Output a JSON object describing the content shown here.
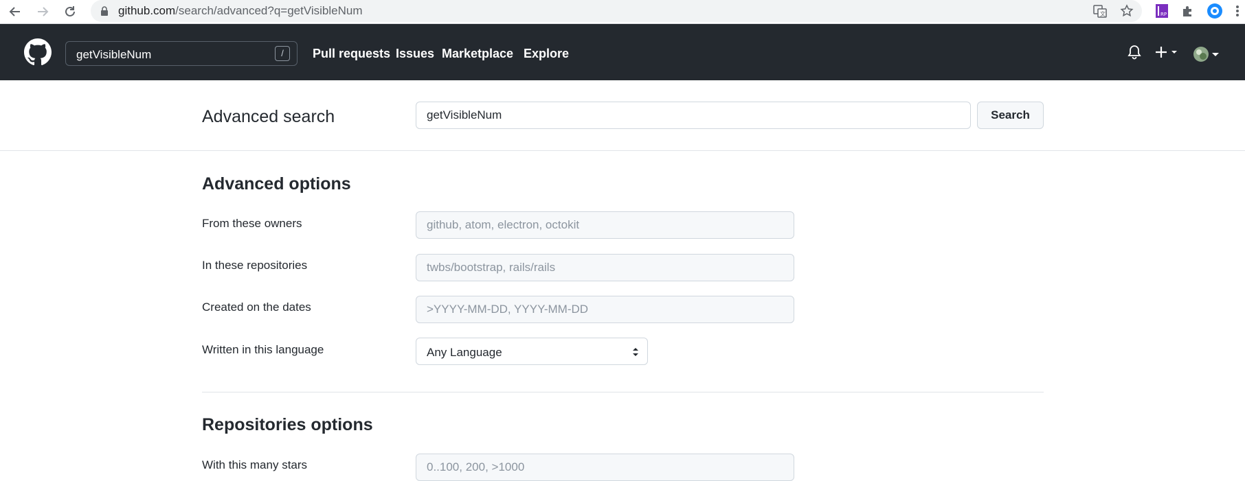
{
  "browser": {
    "url_host": "github.com",
    "url_path": "/search/advanced?q=getVisibleNum"
  },
  "header": {
    "search_value": "getVisibleNum",
    "slash_hint": "/",
    "nav": [
      "Pull requests",
      "Issues",
      "Marketplace",
      "Explore"
    ]
  },
  "page": {
    "title": "Advanced search",
    "search_value": "getVisibleNum",
    "search_button": "Search"
  },
  "advanced_options": {
    "heading": "Advanced options",
    "owners_label": "From these owners",
    "owners_placeholder": "github, atom, electron, octokit",
    "repos_label": "In these repositories",
    "repos_placeholder": "twbs/bootstrap, rails/rails",
    "dates_label": "Created on the dates",
    "dates_placeholder": ">YYYY-MM-DD, YYYY-MM-DD",
    "language_label": "Written in this language",
    "language_selected": "Any Language"
  },
  "repositories_options": {
    "heading": "Repositories options",
    "stars_label": "With this many stars",
    "stars_placeholder": "0..100, 200, >1000"
  },
  "colors": {
    "header_bg": "#24292f",
    "accent_bg": "#f6f8fa",
    "border": "#d0d7de"
  }
}
